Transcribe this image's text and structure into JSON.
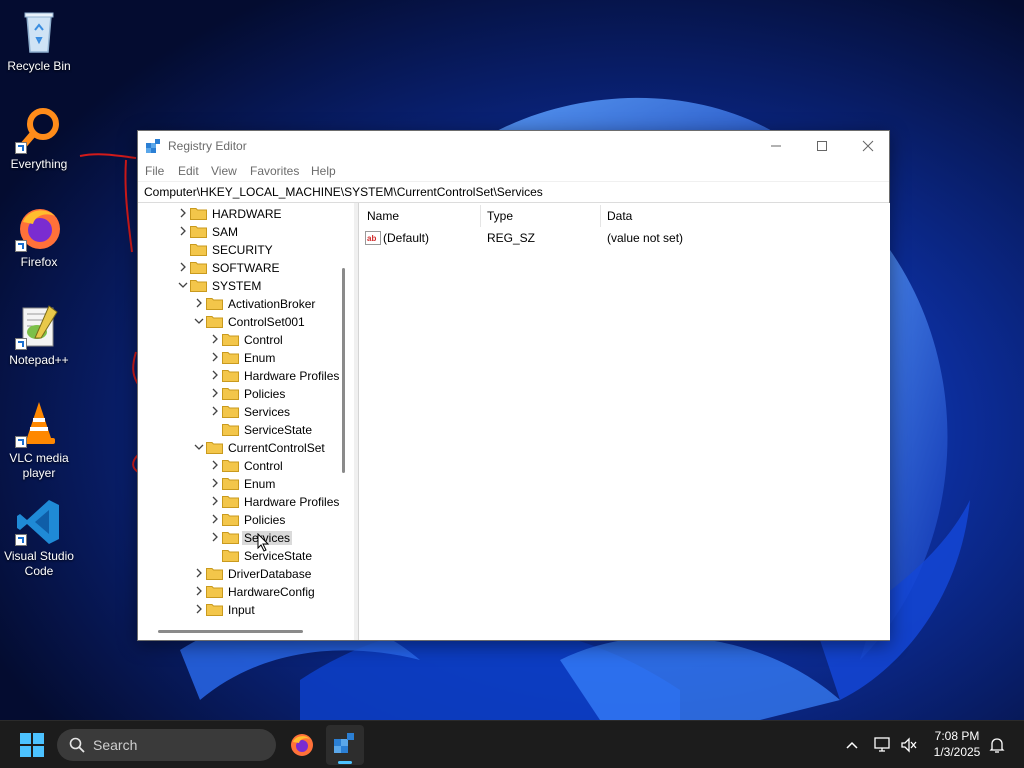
{
  "desktop": {
    "icons": [
      {
        "label": "Recycle Bin",
        "icon": "recycle-bin-icon"
      },
      {
        "label": "Everything",
        "icon": "everything-search-icon"
      },
      {
        "label": "Firefox",
        "icon": "firefox-icon"
      },
      {
        "label": "Notepad++",
        "icon": "notepadpp-icon"
      },
      {
        "label": "VLC media player",
        "icon": "vlc-icon"
      },
      {
        "label": "Visual Studio Code",
        "icon": "vscode-icon"
      }
    ]
  },
  "window": {
    "title": "Registry Editor",
    "menu": [
      "File",
      "Edit",
      "View",
      "Favorites",
      "Help"
    ],
    "address": "Computer\\HKEY_LOCAL_MACHINE\\SYSTEM\\CurrentControlSet\\Services",
    "tree": [
      {
        "label": "HARDWARE",
        "expander": "collapsed"
      },
      {
        "label": "SAM",
        "expander": "collapsed"
      },
      {
        "label": "SECURITY",
        "expander": "none"
      },
      {
        "label": "SOFTWARE",
        "expander": "collapsed"
      },
      {
        "label": "SYSTEM",
        "expander": "expanded"
      },
      {
        "label": "ActivationBroker",
        "expander": "collapsed"
      },
      {
        "label": "ControlSet001",
        "expander": "expanded"
      },
      {
        "label": "Control",
        "expander": "collapsed"
      },
      {
        "label": "Enum",
        "expander": "collapsed"
      },
      {
        "label": "Hardware Profiles",
        "expander": "collapsed"
      },
      {
        "label": "Policies",
        "expander": "collapsed"
      },
      {
        "label": "Services",
        "expander": "collapsed"
      },
      {
        "label": "ServiceState",
        "expander": "none"
      },
      {
        "label": "CurrentControlSet",
        "expander": "expanded"
      },
      {
        "label": "Control",
        "expander": "collapsed"
      },
      {
        "label": "Enum",
        "expander": "collapsed"
      },
      {
        "label": "Hardware Profiles",
        "expander": "collapsed"
      },
      {
        "label": "Policies",
        "expander": "collapsed"
      },
      {
        "label": "Services",
        "expander": "collapsed",
        "selected": true
      },
      {
        "label": "ServiceState",
        "expander": "none"
      },
      {
        "label": "DriverDatabase",
        "expander": "collapsed"
      },
      {
        "label": "HardwareConfig",
        "expander": "collapsed"
      },
      {
        "label": "Input",
        "expander": "collapsed"
      }
    ],
    "list": {
      "columns": [
        "Name",
        "Type",
        "Data"
      ],
      "rows": [
        {
          "name": "(Default)",
          "type": "REG_SZ",
          "data": "(value not set)",
          "icon": "string-value-icon"
        }
      ]
    }
  },
  "taskbar": {
    "search_placeholder": "Search",
    "time": "7:08 PM",
    "date": "1/3/2025"
  },
  "colors": {
    "folder": "#f3c64a",
    "accent": "#1a6fd0",
    "taskbar": "#1c1c1c"
  }
}
